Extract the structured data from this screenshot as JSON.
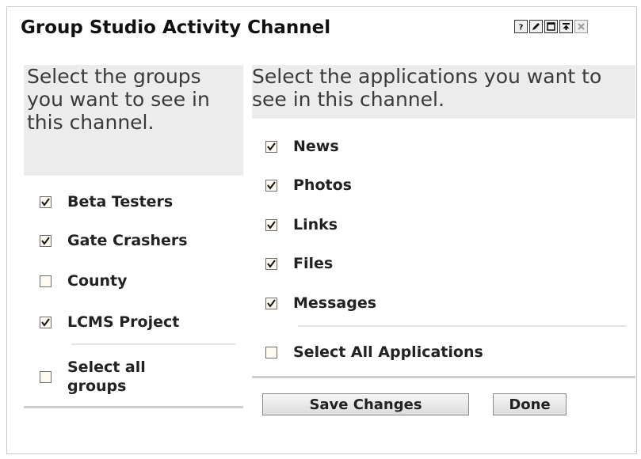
{
  "window": {
    "title": "Group Studio Activity Channel",
    "controls": [
      {
        "name": "help-button",
        "icon": "question-icon"
      },
      {
        "name": "edit-button",
        "icon": "pencil-icon"
      },
      {
        "name": "maximize-button",
        "icon": "window-icon"
      },
      {
        "name": "minimize-button",
        "icon": "collapse-icon"
      },
      {
        "name": "close-button",
        "icon": "close-icon",
        "disabled": true
      }
    ]
  },
  "groups": {
    "header": "Select the groups you want to see in this channel.",
    "items": [
      {
        "label": "Beta Testers",
        "checked": true
      },
      {
        "label": "Gate Crashers",
        "checked": true
      },
      {
        "label": "County",
        "checked": false
      },
      {
        "label": "LCMS Project",
        "checked": true
      }
    ],
    "select_all_label": "Select all groups",
    "select_all_checked": false
  },
  "applications": {
    "header": "Select the applications you want to see in this channel.",
    "items": [
      {
        "label": "News",
        "checked": true
      },
      {
        "label": "Photos",
        "checked": true
      },
      {
        "label": "Links",
        "checked": true
      },
      {
        "label": "Files",
        "checked": true
      },
      {
        "label": "Messages",
        "checked": true
      }
    ],
    "select_all_label": "Select All Applications",
    "select_all_checked": false
  },
  "buttons": {
    "save_label": "Save Changes",
    "done_label": "Done"
  },
  "colors": {
    "header_bg": "#ececec",
    "checkbox_bg": "#fffaf0"
  }
}
